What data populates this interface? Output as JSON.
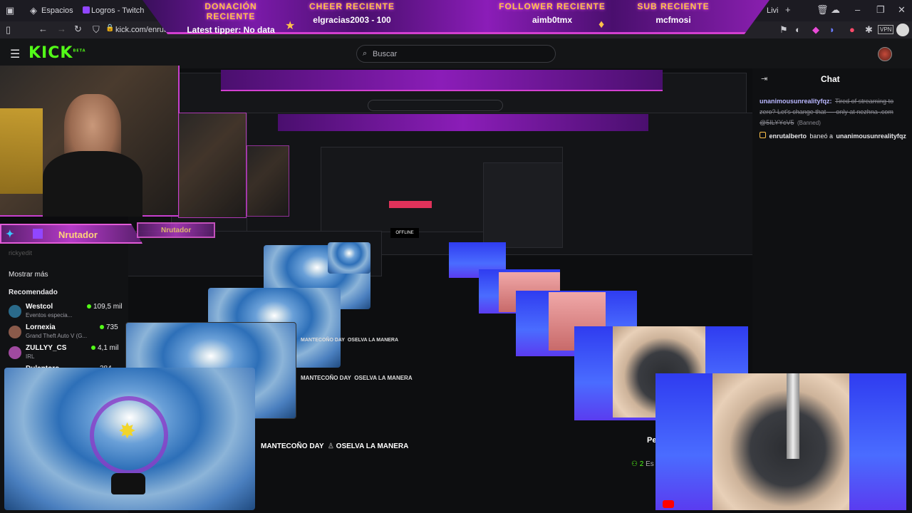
{
  "browser": {
    "tabs": [
      {
        "label": "Espacios"
      },
      {
        "label": "Logros - Twitch"
      }
    ],
    "url": "kick.com/enrutal",
    "right_tab_label": "Livi",
    "vpn_label": "VPN"
  },
  "overlay": {
    "sections": [
      {
        "title": "DONACIÓN RECIENTE",
        "value": "Latest tipper: No data"
      },
      {
        "title": "CHEER RECIENTE",
        "value": "elgracias2003 - 100"
      },
      {
        "title": "FOLLOWER RECIENTE",
        "value": "aimb0tmx"
      },
      {
        "title": "SUB RECIENTE",
        "value": "mcfmosi"
      }
    ],
    "namebar": "Nrutador",
    "namebar_small": "Nrutador"
  },
  "kick": {
    "logo": "KICK",
    "logo_sup": "BETA",
    "search_placeholder": "Buscar"
  },
  "chat": {
    "title": "Chat",
    "messages": [
      {
        "user": "unanimousunrealityfqz:",
        "text": "Tired of streaming to zero? Let's change that — only at nezhna .com @5ILYYcV5",
        "status": "(Banned)"
      }
    ],
    "ban_notice": {
      "actor": "enrutalberto",
      "verb": "baneó a",
      "target": "unanimousunrealityfqz"
    }
  },
  "sidebar": {
    "ghost_user": "rickyedit",
    "show_more": "Mostrar más",
    "recommended": "Recomendado",
    "items": [
      {
        "name": "Westcol",
        "sub": "Eventos especia...",
        "count": "109,5 mil"
      },
      {
        "name": "Lornexia",
        "sub": "Grand Theft Auto V (G...",
        "count": "735"
      },
      {
        "name": "ZULLYY_CS",
        "sub": "IRL",
        "count": "4,1 mil"
      },
      {
        "name": "Dulantoro",
        "sub": "",
        "count": "384"
      }
    ]
  },
  "stream": {
    "tags": [
      "MANTECOÑO DAY",
      "OSELVA LA MANERA"
    ],
    "offline_label": "OFFLINE",
    "side_label": "Pe",
    "follower_count": "2",
    "follower_suffix": "Es"
  },
  "colors": {
    "kick_green": "#53fc18",
    "banner_purple": "#7a1aa8",
    "banner_gold": "#ffc24a",
    "chat_user": "#b9b7ff"
  }
}
